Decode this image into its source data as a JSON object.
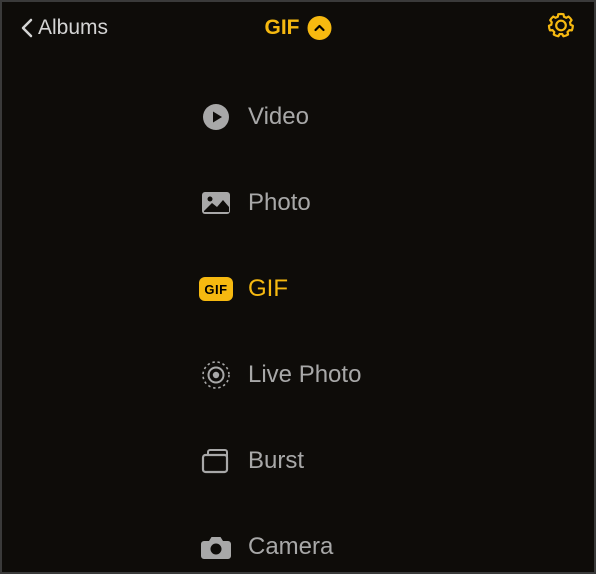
{
  "header": {
    "back_label": "Albums",
    "title": "GIF"
  },
  "menu": {
    "items": [
      {
        "label": "Video",
        "selected": false
      },
      {
        "label": "Photo",
        "selected": false
      },
      {
        "label": "GIF",
        "selected": true,
        "badge_text": "GIF"
      },
      {
        "label": "Live Photo",
        "selected": false
      },
      {
        "label": "Burst",
        "selected": false
      },
      {
        "label": "Camera",
        "selected": false
      }
    ]
  },
  "colors": {
    "accent": "#f6b910",
    "muted": "#a8a8a8",
    "bg": "#0e0c09"
  }
}
